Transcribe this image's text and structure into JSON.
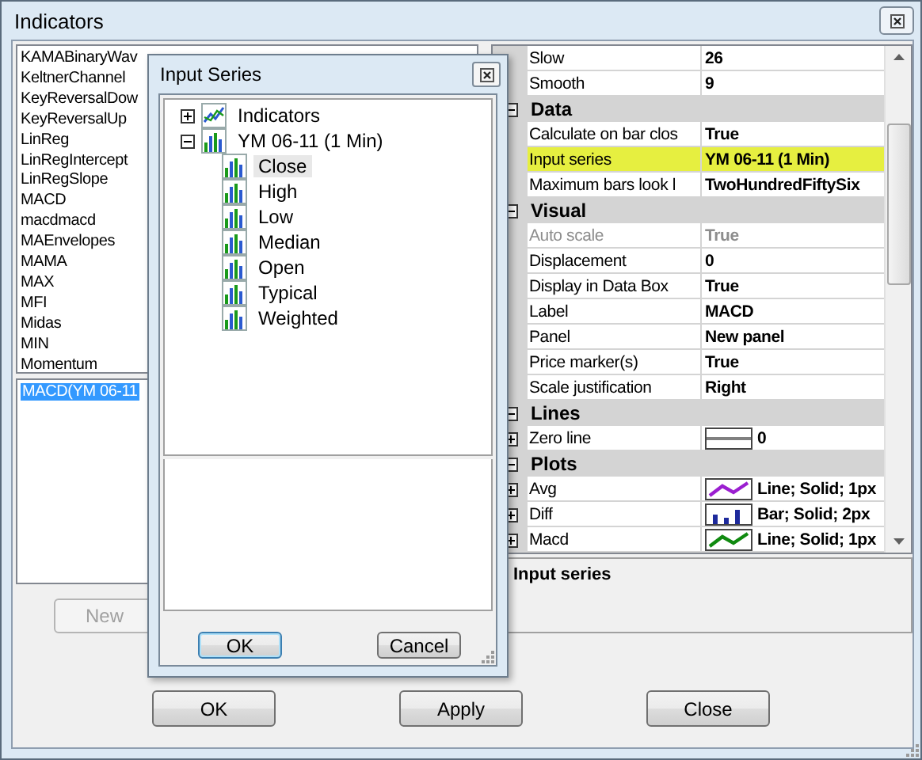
{
  "window": {
    "title": "Indicators"
  },
  "indicator_list": {
    "items": [
      {
        "label": "KAMABinaryWav"
      },
      {
        "label": "KeltnerChannel"
      },
      {
        "label": "KeyReversalDow"
      },
      {
        "label": "KeyReversalUp"
      },
      {
        "label": "LinReg"
      },
      {
        "label": "LinRegIntercept"
      },
      {
        "label": "LinRegSlope"
      },
      {
        "label": "MACD"
      },
      {
        "label": "macdmacd"
      },
      {
        "label": "MAEnvelopes"
      },
      {
        "label": "MAMA"
      },
      {
        "label": "MAX"
      },
      {
        "label": "MFI"
      },
      {
        "label": "Midas"
      },
      {
        "label": "MIN"
      },
      {
        "label": "Momentum"
      }
    ]
  },
  "applied_list": {
    "items": [
      {
        "label": "MACD(YM 06-11",
        "selected": true
      }
    ]
  },
  "new_button": {
    "label": "New",
    "disabled": true
  },
  "properties": {
    "rows": [
      {
        "kind": "property",
        "name": "Slow",
        "value": "26"
      },
      {
        "kind": "property",
        "name": "Smooth",
        "value": "9"
      },
      {
        "kind": "category",
        "name": "Data",
        "expanded": true
      },
      {
        "kind": "property",
        "name": "Calculate on bar clos",
        "value": "True"
      },
      {
        "kind": "property",
        "name": "Input series",
        "value": "YM 06-11 (1 Min)",
        "highlighted": true
      },
      {
        "kind": "property",
        "name": "Maximum bars look l",
        "value": "TwoHundredFiftySix"
      },
      {
        "kind": "category",
        "name": "Visual",
        "expanded": true
      },
      {
        "kind": "property",
        "name": "Auto scale",
        "value": "True",
        "disabled": true
      },
      {
        "kind": "property",
        "name": "Displacement",
        "value": "0"
      },
      {
        "kind": "property",
        "name": "Display in Data Box",
        "value": "True"
      },
      {
        "kind": "property",
        "name": "Label",
        "value": "MACD"
      },
      {
        "kind": "property",
        "name": "Panel",
        "value": "New panel"
      },
      {
        "kind": "property",
        "name": "Price marker(s)",
        "value": "True"
      },
      {
        "kind": "property",
        "name": "Scale justification",
        "value": "Right"
      },
      {
        "kind": "category",
        "name": "Lines",
        "expanded": true
      },
      {
        "kind": "line_style",
        "name": "Zero line",
        "value": "0",
        "expanded": false,
        "color": "#808080"
      },
      {
        "kind": "category",
        "name": "Plots",
        "expanded": true
      },
      {
        "kind": "plot_line",
        "name": "Avg",
        "value": "Line; Solid; 1px",
        "expanded": false,
        "color": "#9b1fd0"
      },
      {
        "kind": "plot_bar",
        "name": "Diff",
        "value": "Bar; Solid; 2px",
        "expanded": false,
        "color": "#1e2a9c"
      },
      {
        "kind": "plot_line",
        "name": "Macd",
        "value": "Line; Solid; 1px",
        "expanded": false,
        "color": "#108a10"
      }
    ]
  },
  "description": {
    "title": "Input series"
  },
  "dialog": {
    "title": "Input Series",
    "tree": [
      {
        "kind": "indicators",
        "label": "Indicators",
        "expanded": false
      },
      {
        "kind": "instrument",
        "label": "YM 06-11 (1 Min)",
        "expanded": true,
        "children": [
          {
            "label": "Close",
            "selected": true
          },
          {
            "label": "High",
            "selected": false
          },
          {
            "label": "Low",
            "selected": false
          },
          {
            "label": "Median",
            "selected": false
          },
          {
            "label": "Open",
            "selected": false
          },
          {
            "label": "Typical",
            "selected": false
          },
          {
            "label": "Weighted",
            "selected": false
          }
        ]
      }
    ],
    "buttons": [
      {
        "label": "OK",
        "default": true
      },
      {
        "label": "Cancel",
        "default": false
      }
    ]
  },
  "buttons": [
    {
      "label": "OK"
    },
    {
      "label": "Apply"
    },
    {
      "label": "Close"
    }
  ]
}
